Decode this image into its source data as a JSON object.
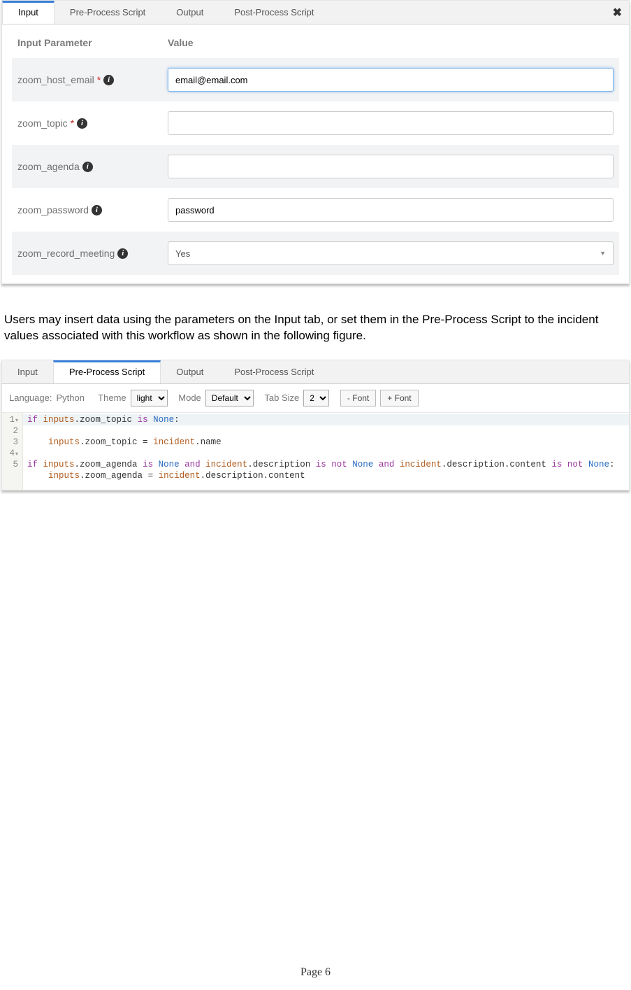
{
  "panel1": {
    "tabs": [
      "Input",
      "Pre-Process Script",
      "Output",
      "Post-Process Script"
    ],
    "active_tab_index": 0,
    "headers": {
      "param": "Input Parameter",
      "value": "Value"
    },
    "rows": [
      {
        "name": "zoom_host_email",
        "required": true,
        "value": "email@email.com",
        "type": "text",
        "focused": true
      },
      {
        "name": "zoom_topic",
        "required": true,
        "value": "",
        "type": "text"
      },
      {
        "name": "zoom_agenda",
        "required": false,
        "value": "",
        "type": "text"
      },
      {
        "name": "zoom_password",
        "required": false,
        "value": "password",
        "type": "text"
      },
      {
        "name": "zoom_record_meeting",
        "required": false,
        "value": "Yes",
        "type": "select"
      }
    ]
  },
  "body_text": "Users may insert data using the parameters on the Input tab, or set them in the Pre-Process Script to the incident values associated with this workflow as shown in the following figure.",
  "panel2": {
    "tabs": [
      "Input",
      "Pre-Process Script",
      "Output",
      "Post-Process Script"
    ],
    "active_tab_index": 1,
    "toolbar": {
      "language_label": "Language:",
      "language_value": "Python",
      "theme_label": "Theme",
      "theme_value": "light",
      "mode_label": "Mode",
      "mode_value": "Default",
      "tabsize_label": "Tab Size",
      "tabsize_value": "2",
      "font_minus": "- Font",
      "font_plus": "+ Font"
    },
    "code_lines": [
      "if inputs.zoom_topic is None:",
      "    inputs.zoom_topic = incident.name",
      "",
      "if inputs.zoom_agenda is None and incident.description is not None and incident.description.content is not None:",
      "    inputs.zoom_agenda = incident.description.content"
    ]
  },
  "footer": "Page 6"
}
